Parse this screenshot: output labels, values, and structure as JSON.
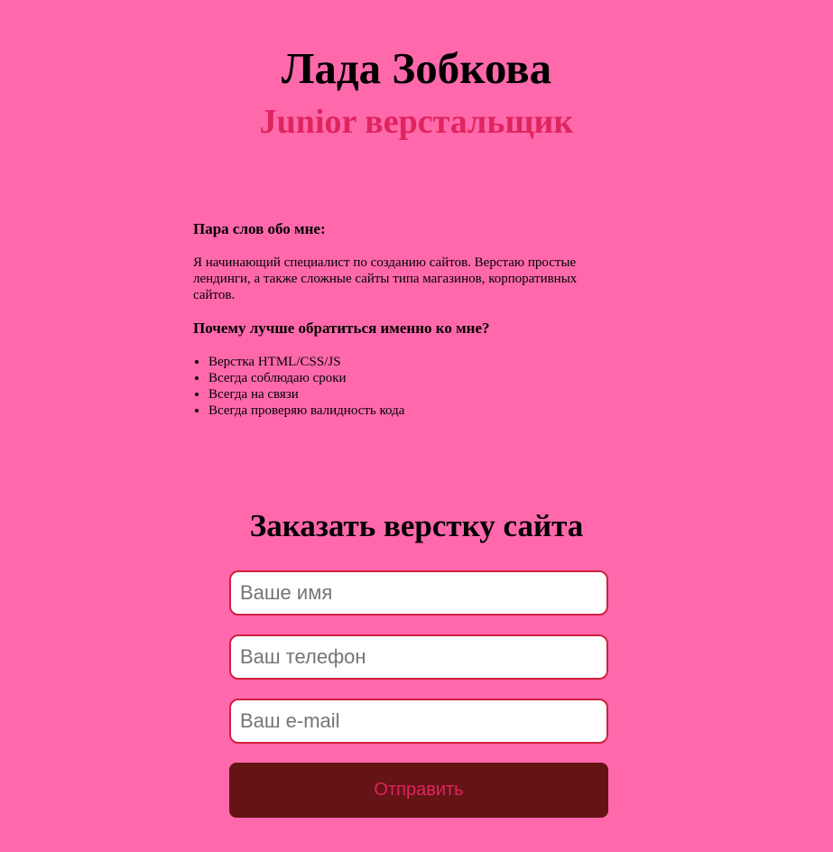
{
  "header": {
    "name": "Лада Зобкова",
    "role": "Junior верстальщик"
  },
  "about": {
    "heading": "Пара слов обо мне:",
    "text": "Я начинающий специалист по созданию сайтов. Верстаю простые лендинги, а также сложные сайты типа магазинов, корпоративных сайтов.",
    "why_heading": "Почему лучше обратиться именно ко мне?",
    "reasons": [
      "Верстка HTML/CSS/JS",
      "Всегда соблюдаю сроки",
      "Всегда на связи",
      "Всегда проверяю валидность кода"
    ]
  },
  "order_form": {
    "title": "Заказать верстку сайта",
    "name_placeholder": "Ваше имя",
    "phone_placeholder": "Ваш телефон",
    "email_placeholder": "Ваш e-mail",
    "submit_label": "Отправить"
  },
  "colors": {
    "background": "#ff69ac",
    "accent": "#e0245e",
    "button_background": "#641414",
    "field_border": "#d0203f"
  }
}
